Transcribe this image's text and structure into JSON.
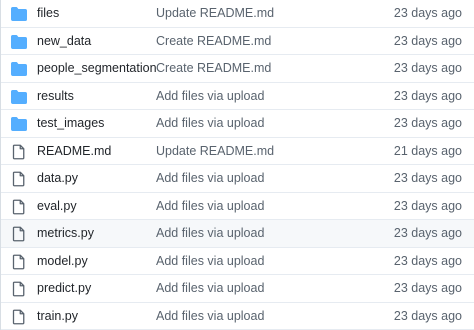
{
  "colors": {
    "folder_icon": "#54aeff",
    "file_icon": "#59636e",
    "row_hover": "#f6f8fa"
  },
  "files": [
    {
      "icon": "folder-icon",
      "name": "files",
      "commit_message": "Update README.md",
      "age": "23 days ago"
    },
    {
      "icon": "folder-icon",
      "name": "new_data",
      "commit_message": "Create README.md",
      "age": "23 days ago"
    },
    {
      "icon": "folder-icon",
      "name": "people_segmentation",
      "commit_message": "Create README.md",
      "age": "23 days ago"
    },
    {
      "icon": "folder-icon",
      "name": "results",
      "commit_message": "Add files via upload",
      "age": "23 days ago"
    },
    {
      "icon": "folder-icon",
      "name": "test_images",
      "commit_message": "Add files via upload",
      "age": "23 days ago"
    },
    {
      "icon": "file-icon",
      "name": "README.md",
      "commit_message": "Update README.md",
      "age": "21 days ago"
    },
    {
      "icon": "file-icon",
      "name": "data.py",
      "commit_message": "Add files via upload",
      "age": "23 days ago"
    },
    {
      "icon": "file-icon",
      "name": "eval.py",
      "commit_message": "Add files via upload",
      "age": "23 days ago"
    },
    {
      "icon": "file-icon",
      "name": "metrics.py",
      "commit_message": "Add files via upload",
      "age": "23 days ago"
    },
    {
      "icon": "file-icon",
      "name": "model.py",
      "commit_message": "Add files via upload",
      "age": "23 days ago"
    },
    {
      "icon": "file-icon",
      "name": "predict.py",
      "commit_message": "Add files via upload",
      "age": "23 days ago"
    },
    {
      "icon": "file-icon",
      "name": "train.py",
      "commit_message": "Add files via upload",
      "age": "23 days ago"
    }
  ]
}
